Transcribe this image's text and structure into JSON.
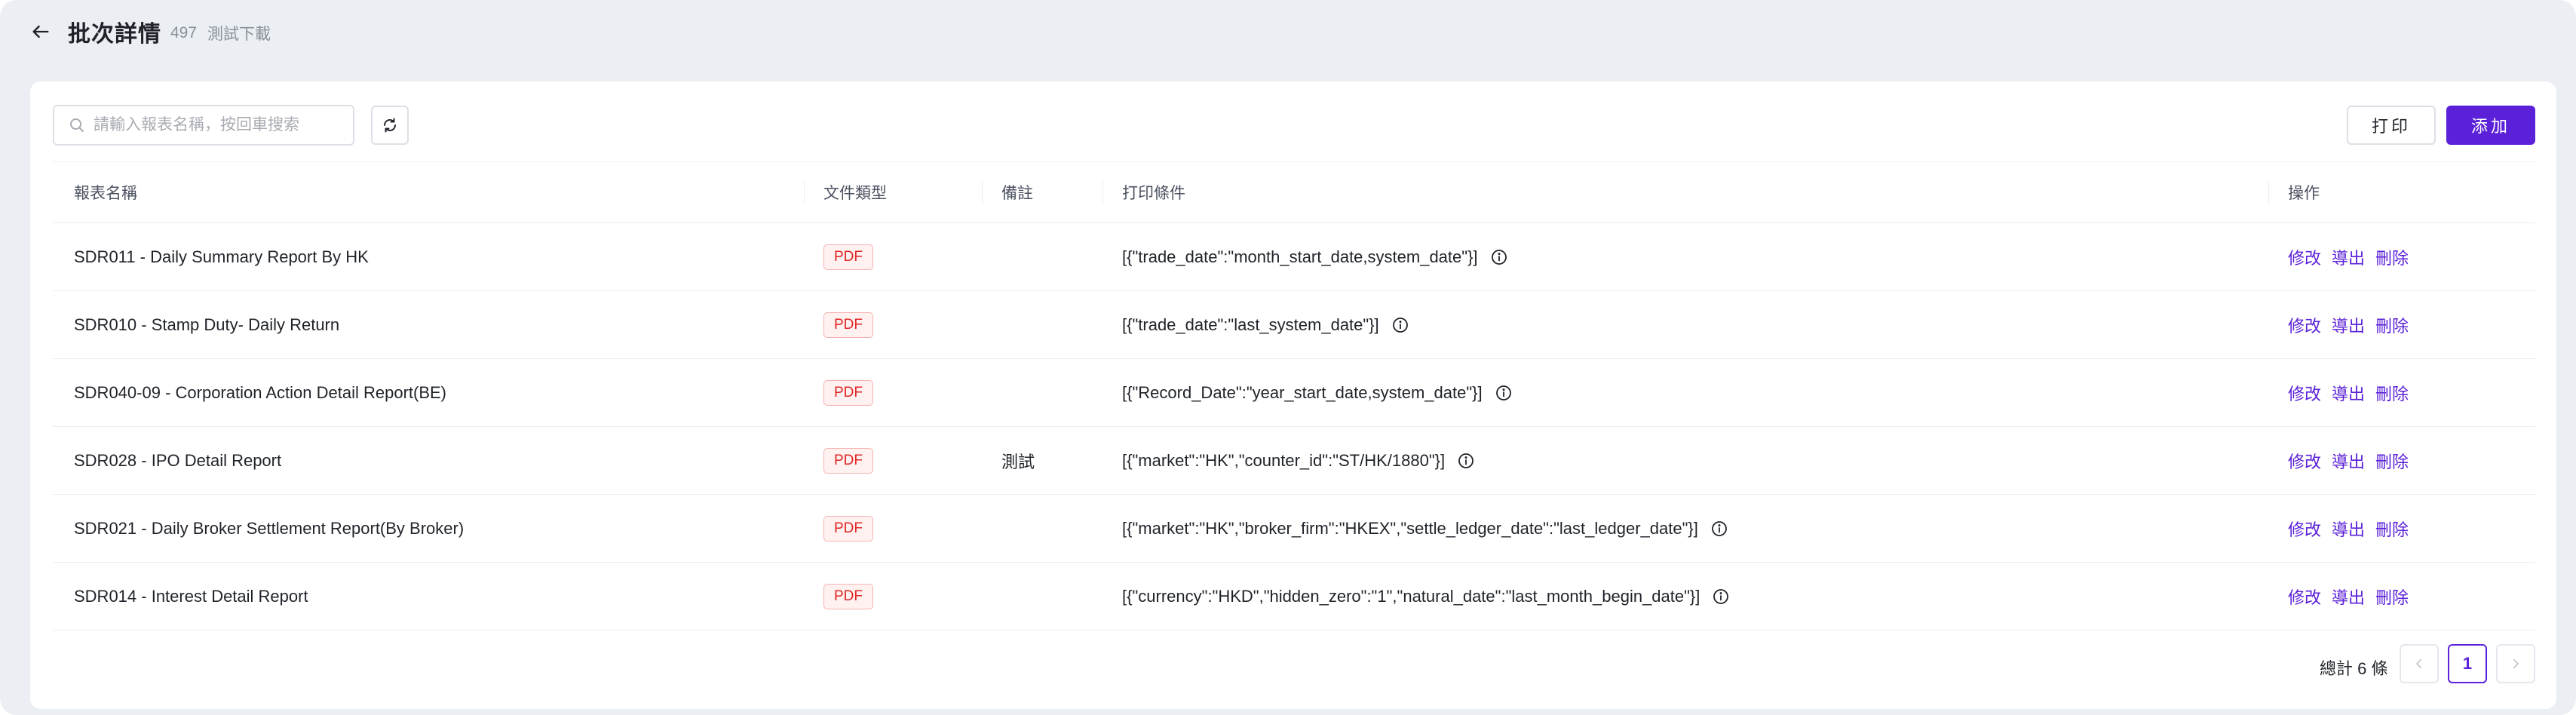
{
  "header": {
    "title": "批次詳情",
    "batch_number": "497",
    "batch_name": "測試下載"
  },
  "toolbar": {
    "search_placeholder": "請輸入報表名稱，按回車搜索",
    "print_label": "打印",
    "add_label": "添加"
  },
  "table": {
    "columns": [
      "報表名稱",
      "文件類型",
      "備註",
      "打印條件",
      "操作"
    ],
    "rows": [
      {
        "name": "SDR011 - Daily Summary Report By HK",
        "type": "PDF",
        "remark": "",
        "condition": "[{\"trade_date\":\"month_start_date,system_date\"}]"
      },
      {
        "name": "SDR010 - Stamp Duty- Daily Return",
        "type": "PDF",
        "remark": "",
        "condition": "[{\"trade_date\":\"last_system_date\"}]"
      },
      {
        "name": "SDR040-09 - Corporation Action Detail Report(BE)",
        "type": "PDF",
        "remark": "",
        "condition": "[{\"Record_Date\":\"year_start_date,system_date\"}]"
      },
      {
        "name": "SDR028 - IPO Detail Report",
        "type": "PDF",
        "remark": "測試",
        "condition": "[{\"market\":\"HK\",\"counter_id\":\"ST/HK/1880\"}]"
      },
      {
        "name": "SDR021 - Daily Broker Settlement Report(By Broker)",
        "type": "PDF",
        "remark": "",
        "condition": "[{\"market\":\"HK\",\"broker_firm\":\"HKEX\",\"settle_ledger_date\":\"last_ledger_date\"}]"
      },
      {
        "name": "SDR014 - Interest Detail Report",
        "type": "PDF",
        "remark": "",
        "condition": "[{\"currency\":\"HKD\",\"hidden_zero\":\"1\",\"natural_date\":\"last_month_begin_date\"}]"
      }
    ],
    "actions": {
      "edit": "修改",
      "export": "導出",
      "delete": "刪除"
    }
  },
  "pagination": {
    "total_label": "總計 6 條",
    "current_page": "1"
  },
  "colors": {
    "accent": "#5b21d8",
    "pdf_tag": "#e02424",
    "page_bg": "#ebeef2"
  },
  "icons": [
    "arrow-left-icon",
    "search-icon",
    "refresh-icon",
    "info-icon",
    "chevron-left-icon",
    "chevron-right-icon"
  ]
}
